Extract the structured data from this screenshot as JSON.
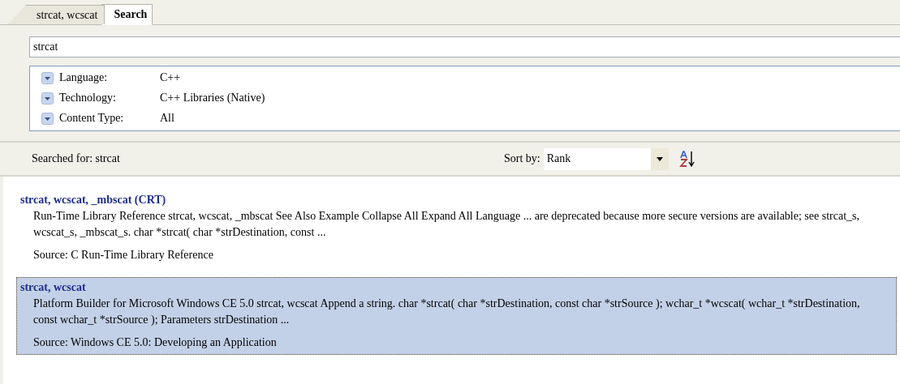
{
  "tabs": [
    {
      "label": "strcat, wcscat",
      "selected": false
    },
    {
      "label": "Search",
      "selected": true
    }
  ],
  "search": {
    "value": "strcat"
  },
  "filters": [
    {
      "label": "Language:",
      "value": "C++"
    },
    {
      "label": "Technology:",
      "value": "C++ Libraries (Native)"
    },
    {
      "label": "Content Type:",
      "value": "All"
    }
  ],
  "status": {
    "searched_for": "Searched for: strcat",
    "sort_label": "Sort by:",
    "sort_value": "Rank"
  },
  "results": [
    {
      "title": "strcat, wcscat, _mbscat (CRT)",
      "snippet": "Run-Time Library Reference strcat, wcscat, _mbscat See Also Example Collapse All Expand All Language ... are deprecated because more secure versions are available; see strcat_s, wcscat_s, _mbscat_s. char *strcat( char *strDestination, const ...",
      "source": "Source:  C Run-Time Library Reference",
      "selected": false
    },
    {
      "title": "strcat, wcscat",
      "snippet": "Platform Builder for Microsoft Windows CE 5.0 strcat, wcscat Append a string. char *strcat( char *strDestination, const char *strSource ); wchar_t *wcscat( wchar_t *strDestination, const wchar_t *strSource ); Parameters strDestination ...",
      "source": "Source:  Windows CE 5.0: Developing an Application",
      "selected": true
    }
  ]
}
